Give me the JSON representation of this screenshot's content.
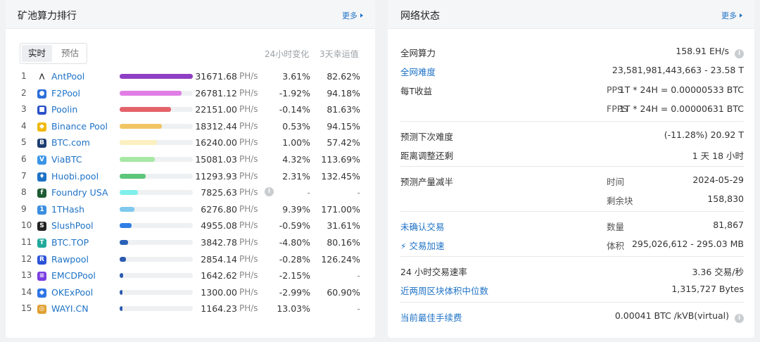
{
  "left": {
    "title": "矿池算力排行",
    "more": "更多",
    "tabs": [
      "实时",
      "预估"
    ],
    "col_change": "24小时变化",
    "col_luck": "3天幸运值",
    "unit": "PH/s",
    "pools": [
      {
        "rank": "1",
        "name": "AntPool",
        "hashrate": "31671.68",
        "change": "3.61%",
        "luck": "82.62%",
        "fill": 1.0,
        "bar_color": "#8e3fc4",
        "icon": "antpool-icon",
        "icon_color": "#ffffff"
      },
      {
        "rank": "2",
        "name": "F2Pool",
        "hashrate": "26781.12",
        "change": "-1.92%",
        "luck": "94.18%",
        "fill": 0.85,
        "bar_color": "#e07ee6",
        "icon": "f2pool-icon",
        "icon_color": "#2b6fd9"
      },
      {
        "rank": "3",
        "name": "Poolin",
        "hashrate": "22151.00",
        "change": "-0.14%",
        "luck": "81.63%",
        "fill": 0.7,
        "bar_color": "#e4636b",
        "icon": "poolin-icon",
        "icon_color": "#2a4fc8"
      },
      {
        "rank": "4",
        "name": "Binance Pool",
        "hashrate": "18312.44",
        "change": "0.53%",
        "luck": "94.15%",
        "fill": 0.58,
        "bar_color": "#f0c565",
        "icon": "binance-icon",
        "icon_color": "#f0b90b"
      },
      {
        "rank": "5",
        "name": "BTC.com",
        "hashrate": "16240.00",
        "change": "1.00%",
        "luck": "57.42%",
        "fill": 0.51,
        "bar_color": "#fbeec0",
        "icon": "btccom-icon",
        "icon_color": "#1d3d70"
      },
      {
        "rank": "6",
        "name": "ViaBTC",
        "hashrate": "15081.03",
        "change": "4.32%",
        "luck": "113.69%",
        "fill": 0.48,
        "bar_color": "#a6e8a4",
        "icon": "viabtc-icon",
        "icon_color": "#3b95e6"
      },
      {
        "rank": "7",
        "name": "Huobi.pool",
        "hashrate": "11293.93",
        "change": "2.31%",
        "luck": "132.45%",
        "fill": 0.36,
        "bar_color": "#5dc67a",
        "icon": "huobi-icon",
        "icon_color": "#1e72c6"
      },
      {
        "rank": "8",
        "name": "Foundry USA",
        "hashrate": "7825.63",
        "change": "-",
        "luck": "-",
        "fill": 0.25,
        "bar_color": "#7ff0ec",
        "icon": "foundry-icon",
        "icon_color": "#1f5b33",
        "has_info": true
      },
      {
        "rank": "9",
        "name": "1THash",
        "hashrate": "6276.80",
        "change": "9.39%",
        "luck": "171.00%",
        "fill": 0.2,
        "bar_color": "#7fc9ee",
        "icon": "1thash-icon",
        "icon_color": "#3b8ee0"
      },
      {
        "rank": "10",
        "name": "SlushPool",
        "hashrate": "4955.08",
        "change": "-0.59%",
        "luck": "31.61%",
        "fill": 0.16,
        "bar_color": "#2f7ee6",
        "icon": "slushpool-icon",
        "icon_color": "#222222"
      },
      {
        "rank": "11",
        "name": "BTC.TOP",
        "hashrate": "3842.78",
        "change": "-4.80%",
        "luck": "80.16%",
        "fill": 0.12,
        "bar_color": "#2a62b8",
        "icon": "btctop-icon",
        "icon_color": "#1fa99a"
      },
      {
        "rank": "12",
        "name": "Rawpool",
        "hashrate": "2854.14",
        "change": "-0.28%",
        "luck": "126.24%",
        "fill": 0.09,
        "bar_color": "#2d5bb0",
        "icon": "rawpool-icon",
        "icon_color": "#2a52d8"
      },
      {
        "rank": "13",
        "name": "EMCDPool",
        "hashrate": "1642.62",
        "change": "-2.15%",
        "luck": "-",
        "fill": 0.05,
        "bar_color": "#2d5bb0",
        "icon": "emcd-icon",
        "icon_color": "#7a3ce0"
      },
      {
        "rank": "14",
        "name": "OKExPool",
        "hashrate": "1300.00",
        "change": "-2.99%",
        "luck": "60.90%",
        "fill": 0.04,
        "bar_color": "#2d5bb0",
        "icon": "okex-icon",
        "icon_color": "#2f74e6"
      },
      {
        "rank": "15",
        "name": "WAYI.CN",
        "hashrate": "1164.23",
        "change": "13.03%",
        "luck": "-",
        "fill": 0.037,
        "bar_color": "#2d5bb0",
        "icon": "wayi-icon",
        "icon_color": "#e0a030"
      }
    ]
  },
  "right": {
    "title": "网络状态",
    "more": "更多",
    "hashrate_label": "全网算力",
    "hashrate_value": "158.91 EH/s",
    "difficulty_label": "全网难度",
    "difficulty_value": "23,581,981,443,663 - 23.58 T",
    "earning_label": "每T收益",
    "pps_label": "PPS",
    "pps_value": "1T * 24H = 0.00000533 BTC",
    "fpps_label": "FPPS",
    "fpps_value": "1T * 24H = 0.00000631 BTC",
    "next_diff_label": "预测下次难度",
    "next_diff_value": "(-11.28%) 20.92 T",
    "adjust_label": "距离调整还剩",
    "adjust_value": "1 天 18 小时",
    "halving_label": "预测产量减半",
    "halving_time_label": "时间",
    "halving_time_value": "2024-05-29",
    "halving_blocks_label": "剩余块",
    "halving_blocks_value": "158,830",
    "unconfirmed_label": "未确认交易",
    "accelerate_label": "交易加速",
    "count_label": "数量",
    "count_value": "81,867",
    "size_label": "体积",
    "size_value": "295,026,612 - 295.03 MB",
    "tx_rate_label": "24 小时交易速率",
    "tx_rate_value": "3.36 交易/秒",
    "block_median_label": "近两周区块体积中位数",
    "block_median_value": "1,315,727 Bytes",
    "fee_label": "当前最佳手续费",
    "fee_value": "0.00041 BTC /kVB(virtual)"
  }
}
